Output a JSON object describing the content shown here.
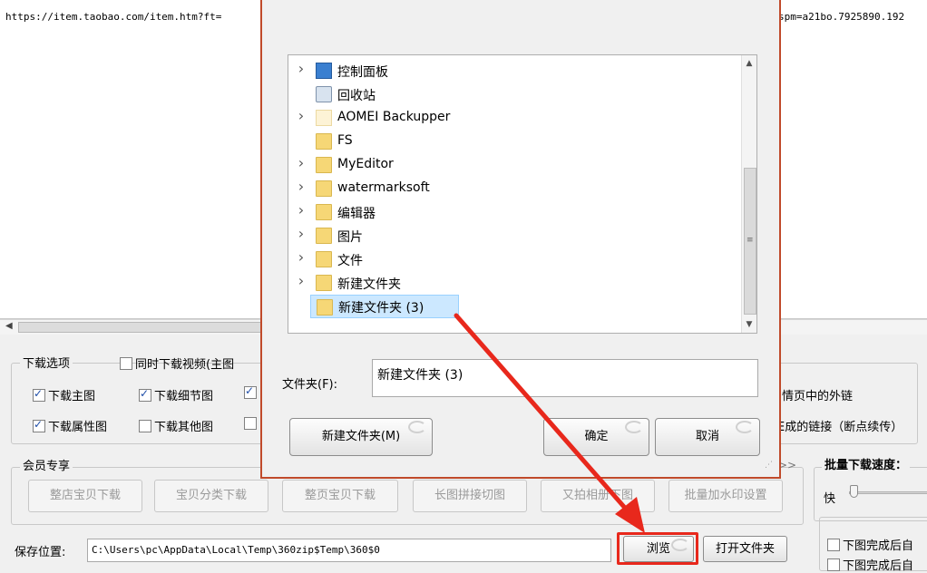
{
  "url": {
    "left_text": "https://item.taobao.com/item.htm?ft=",
    "right_text": "spm=a21bo.7925890.192"
  },
  "download_options": {
    "legend": "下载选项",
    "sync_video_label": "同时下载视频(主图",
    "main_image": "下载主图",
    "detail_image": "下载细节图",
    "attr_image": "下载属性图",
    "other_image": "下载其他图",
    "right_text_1": "情页中的外链",
    "right_text_2": "E成的链接（断点续传）"
  },
  "member": {
    "legend": "会员专享",
    "buttons": [
      "整店宝贝下载",
      "宝贝分类下载",
      "整页宝贝下载",
      "长图拼接切图",
      "又拍相册下图",
      "批量加水印设置"
    ],
    "more": ">>"
  },
  "speed": {
    "legend": "批量下载速度：",
    "fast_label": "快",
    "check_1": "下图完成后自",
    "check_2": "下图完成后自"
  },
  "save": {
    "label": "保存位置:",
    "path": "C:\\Users\\pc\\AppData\\Local\\Temp\\360zip$Temp\\360$0",
    "browse": "浏览",
    "open_folder": "打开文件夹"
  },
  "dialog": {
    "tree_items": [
      {
        "label": "控制面板",
        "icon": "control-panel-icon",
        "chevron": true
      },
      {
        "label": "回收站",
        "icon": "recycle-bin-icon",
        "chevron": false
      },
      {
        "label": "AOMEI Backupper",
        "icon": "folder-icon",
        "chevron": true
      },
      {
        "label": "FS",
        "icon": "folder-icon",
        "chevron": false
      },
      {
        "label": "MyEditor",
        "icon": "folder-icon",
        "chevron": true
      },
      {
        "label": "watermarksoft",
        "icon": "folder-icon",
        "chevron": true
      },
      {
        "label": "编辑器",
        "icon": "folder-icon",
        "chevron": true
      },
      {
        "label": "图片",
        "icon": "folder-icon",
        "chevron": true
      },
      {
        "label": "文件",
        "icon": "folder-icon",
        "chevron": true
      },
      {
        "label": "新建文件夹",
        "icon": "folder-icon",
        "chevron": true
      },
      {
        "label": "新建文件夹 (3)",
        "icon": "folder-icon",
        "chevron": false,
        "selected": true
      }
    ],
    "folder_label": "文件夹(F):",
    "folder_value": "新建文件夹 (3)",
    "new_folder_button": "新建文件夹(M)",
    "ok_button": "确定",
    "cancel_button": "取消"
  },
  "colors": {
    "highlight_box": "#e8281c",
    "arrow": "#e8281c",
    "selected_bg": "#cce8ff"
  }
}
